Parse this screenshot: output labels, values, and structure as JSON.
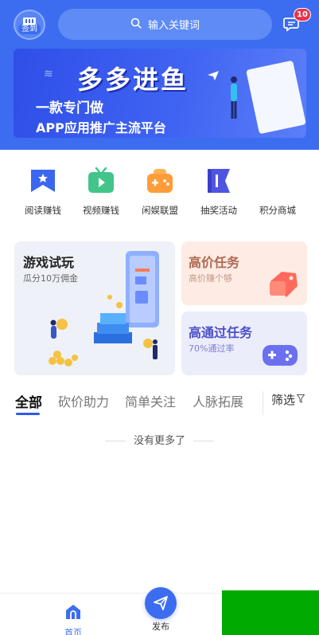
{
  "header": {
    "signin_label": "签到",
    "search_placeholder": "输入关键词",
    "message_badge": "10"
  },
  "banner": {
    "title": "多多进鱼",
    "line1": "一款专门做",
    "line2": "APP应用推广主流平台"
  },
  "categories": [
    {
      "label": "阅读赚钱",
      "icon": "flag-star-icon",
      "color": "#3b66f0"
    },
    {
      "label": "视频赚钱",
      "icon": "tv-play-icon",
      "color": "#43c58a"
    },
    {
      "label": "闲娱联盟",
      "icon": "gamepad-icon",
      "color": "#ff9c3a"
    },
    {
      "label": "抽奖活动",
      "icon": "banner-flag-icon",
      "color": "#4f55e3"
    },
    {
      "label": "积分商城",
      "icon": "shop-icon",
      "color": "#999999"
    }
  ],
  "promo": {
    "game": {
      "title": "游戏试玩",
      "subtitle": "瓜分10万佣金"
    },
    "high": {
      "title": "高价任务",
      "subtitle": "高价赚个够"
    },
    "pass": {
      "title": "高通过任务",
      "subtitle": "70%通过率"
    }
  },
  "tabs": [
    {
      "label": "全部",
      "active": true
    },
    {
      "label": "砍价助力",
      "active": false
    },
    {
      "label": "简单关注",
      "active": false
    },
    {
      "label": "人脉拓展",
      "active": false
    }
  ],
  "filter_label": "筛选",
  "empty_text": "没有更多了",
  "tabbar": {
    "home_label": "首页",
    "publish_label": "发布"
  },
  "colors": {
    "primary": "#3c6df0",
    "badge": "#e8334a",
    "overlay_green": "#00aa00"
  }
}
